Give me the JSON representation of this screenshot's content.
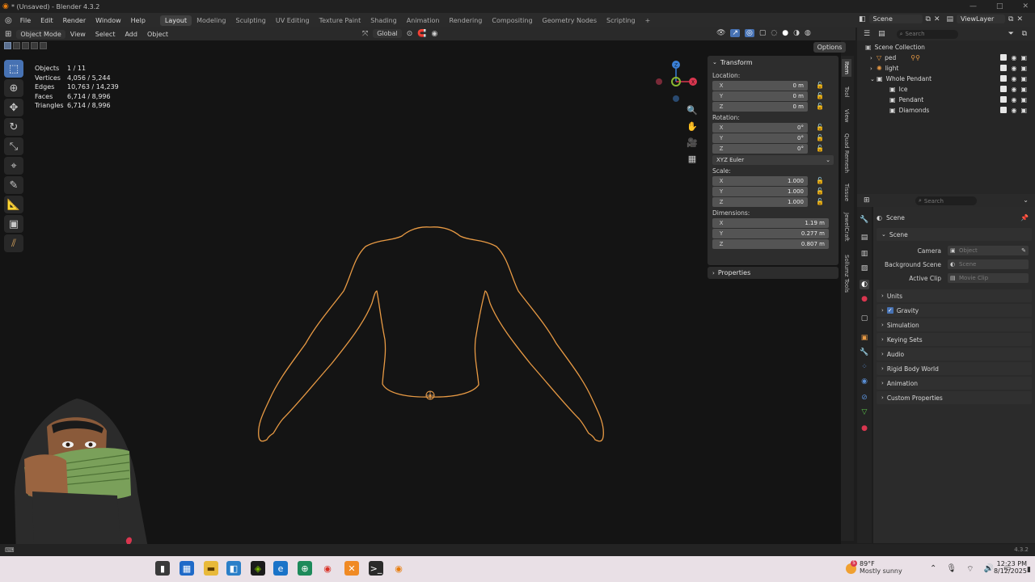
{
  "window": {
    "title": "* (Unsaved) - Blender 4.3.2"
  },
  "menu": [
    "File",
    "Edit",
    "Render",
    "Window",
    "Help"
  ],
  "workspaces": [
    {
      "label": "Layout",
      "active": true
    },
    {
      "label": "Modeling",
      "active": false
    },
    {
      "label": "Sculpting",
      "active": false
    },
    {
      "label": "UV Editing",
      "active": false
    },
    {
      "label": "Texture Paint",
      "active": false
    },
    {
      "label": "Shading",
      "active": false
    },
    {
      "label": "Animation",
      "active": false
    },
    {
      "label": "Rendering",
      "active": false
    },
    {
      "label": "Compositing",
      "active": false
    },
    {
      "label": "Geometry Nodes",
      "active": false
    },
    {
      "label": "Scripting",
      "active": false
    }
  ],
  "add_workspace": "+",
  "scene_selector": "Scene",
  "view_layer": "ViewLayer",
  "viewport_header": {
    "mode": "Object Mode",
    "view": "View",
    "select": "Select",
    "add": "Add",
    "object": "Object",
    "orientation": "Global",
    "options": "Options"
  },
  "stats": [
    {
      "key": "Objects",
      "value": "1 / 11"
    },
    {
      "key": "Vertices",
      "value": "4,056 / 5,244"
    },
    {
      "key": "Edges",
      "value": "10,763 / 14,239"
    },
    {
      "key": "Faces",
      "value": "6,714 / 8,996"
    },
    {
      "key": "Triangles",
      "value": "6,714 / 8,996"
    }
  ],
  "gizmo": {
    "x": "X",
    "y": "Y",
    "z": "Z"
  },
  "transform_panel": {
    "title": "Transform",
    "location_label": "Location:",
    "location": [
      {
        "axis": "X",
        "value": "0 m"
      },
      {
        "axis": "Y",
        "value": "0 m"
      },
      {
        "axis": "Z",
        "value": "0 m"
      }
    ],
    "rotation_label": "Rotation:",
    "rotation": [
      {
        "axis": "X",
        "value": "0°"
      },
      {
        "axis": "Y",
        "value": "0°"
      },
      {
        "axis": "Z",
        "value": "0°"
      }
    ],
    "rotation_mode": "XYZ Euler",
    "scale_label": "Scale:",
    "scale": [
      {
        "axis": "X",
        "value": "1.000"
      },
      {
        "axis": "Y",
        "value": "1.000"
      },
      {
        "axis": "Z",
        "value": "1.000"
      }
    ],
    "dimensions_label": "Dimensions:",
    "dimensions": [
      {
        "axis": "X",
        "value": "1.19 m"
      },
      {
        "axis": "Y",
        "value": "0.277 m"
      },
      {
        "axis": "Z",
        "value": "0.807 m"
      }
    ],
    "properties_label": "Properties"
  },
  "sidebar_tabs": [
    "Item",
    "Tool",
    "View",
    "Quad Remesh",
    "Tissue",
    "JewelCraft",
    "Sollumz Tools"
  ],
  "outliner": {
    "search_placeholder": "Search",
    "root": "Scene Collection",
    "items": [
      {
        "label": "ped",
        "indent": 1
      },
      {
        "label": "light",
        "indent": 1
      },
      {
        "label": "Whole Pendant",
        "indent": 1
      },
      {
        "label": "Ice",
        "indent": 2
      },
      {
        "label": "Pendant",
        "indent": 2
      },
      {
        "label": "Diamonds",
        "indent": 2
      }
    ]
  },
  "properties": {
    "search_placeholder": "Search",
    "context": "Scene",
    "section": "Scene",
    "camera_label": "Camera",
    "camera_placeholder": "Object",
    "background_scene_label": "Background Scene",
    "background_scene_placeholder": "Scene",
    "active_clip_label": "Active Clip",
    "active_clip_placeholder": "Movie Clip",
    "panels": [
      "Units",
      "Gravity",
      "Simulation",
      "Keying Sets",
      "Audio",
      "Rigid Body World",
      "Animation",
      "Custom Properties"
    ]
  },
  "version": "4.3.2",
  "taskbar": {
    "weather_temp": "89°F",
    "weather_cond": "Mostly sunny",
    "weather_badge": "5",
    "time": "12:23 PM",
    "date": "8/12/2025"
  },
  "colors": {
    "selection_outline": "#e89a44",
    "active_tool": "#4772b3",
    "gizmo_x": "#d9364f",
    "gizmo_y": "#8bb832",
    "gizmo_z": "#3a7fd6"
  }
}
